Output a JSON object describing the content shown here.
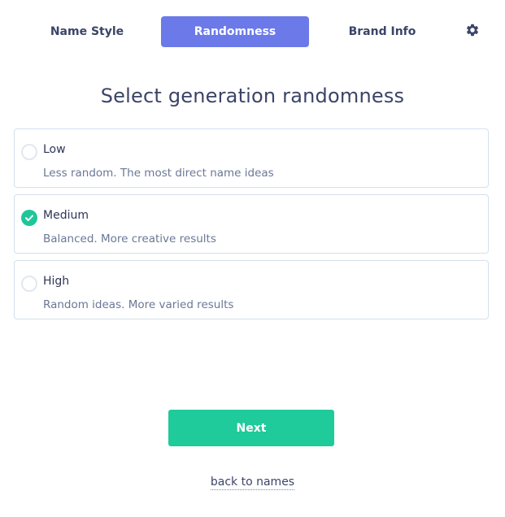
{
  "tabs": {
    "name_style": "Name Style",
    "randomness": "Randomness",
    "brand_info": "Brand Info",
    "settings_icon": "gear-icon",
    "active": "randomness",
    "active_color": "#6b7ae8"
  },
  "title": "Select generation randomness",
  "options": [
    {
      "label": "Low",
      "description": "Less random. The most direct name ideas",
      "selected": false
    },
    {
      "label": "Medium",
      "description": "Balanced. More creative results",
      "selected": true
    },
    {
      "label": "High",
      "description": "Random ideas. More varied results",
      "selected": false
    }
  ],
  "selected_color": "#1fc69a",
  "next_button": "Next",
  "next_color": "#1fca9b",
  "back_link": "back to names"
}
